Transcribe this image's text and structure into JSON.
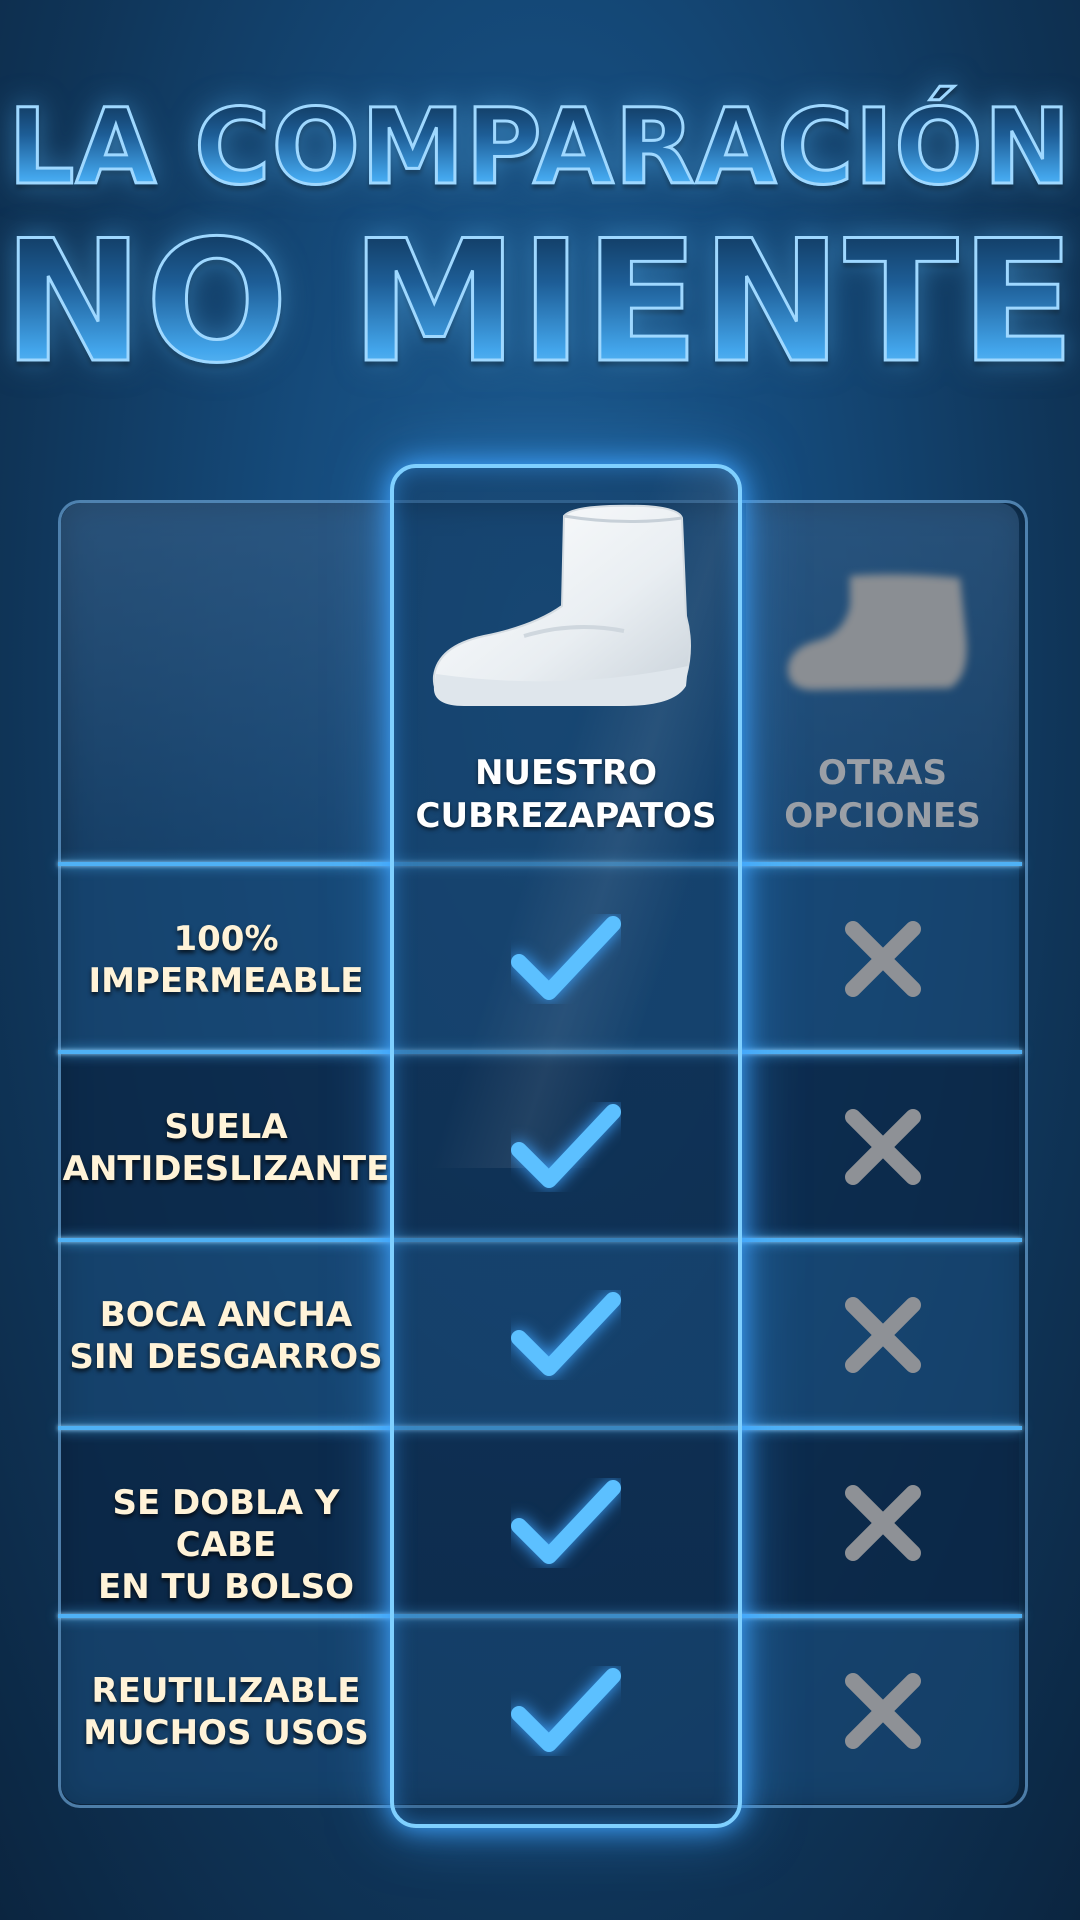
{
  "title": {
    "line1": "LA COMPARACIÓN",
    "line2": "NO MIENTE"
  },
  "columns": {
    "ours": "NUESTRO\nCUBREZAPATOS",
    "others": "OTRAS\nOPCIONES"
  },
  "rows": [
    {
      "label": "100%\nIMPERMEABLE",
      "ours": "check-icon",
      "others": "cross-icon"
    },
    {
      "label": "SUELA\nANTIDESLIZANTE",
      "ours": "check-icon",
      "others": "cross-icon"
    },
    {
      "label": "BOCA ANCHA\nSIN DESGARROS",
      "ours": "check-icon",
      "others": "cross-icon"
    },
    {
      "label": "SE DOBLA Y CABE\nEN TU BOLSO",
      "ours": "check-icon",
      "others": "cross-icon"
    },
    {
      "label": "REUTILIZABLE\nMUCHOS USOS",
      "ours": "check-icon",
      "others": "cross-icon"
    }
  ],
  "colors": {
    "accent": "#4fb1f5",
    "check": "#5cc0ff",
    "cross": "#8e9196",
    "label": "#fff3d8"
  }
}
